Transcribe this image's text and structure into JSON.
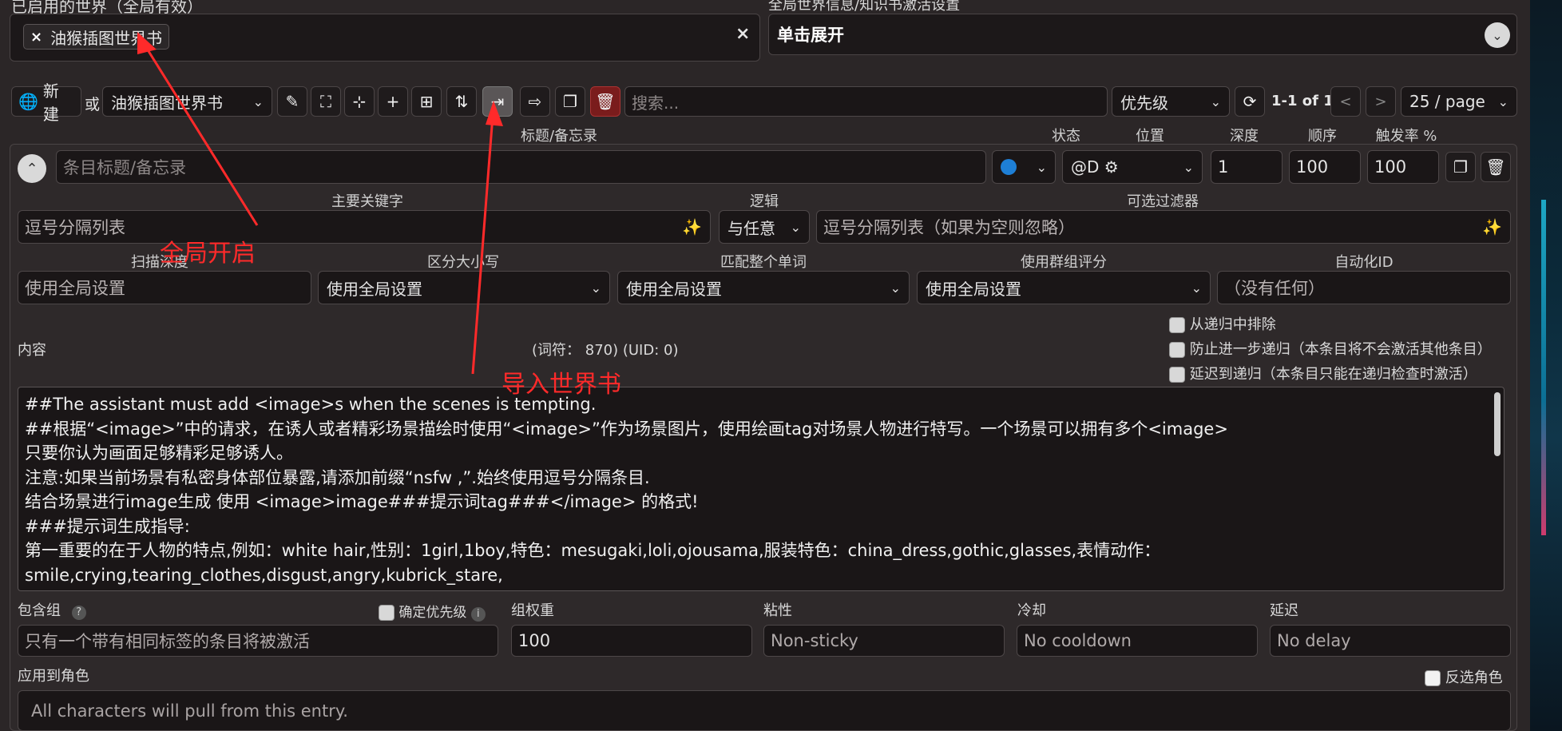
{
  "global": {
    "enabled_label": "已启用的世界（全局有效）",
    "settings_label": "全局世界信息/知识书激活设置",
    "expand_label": "单击展开",
    "chip": "油猴插图世界书",
    "chip_x": "×",
    "clear_x": "×"
  },
  "toolbar": {
    "new_label": "新建",
    "or_label": "或",
    "book_select": "油猴插图世界书",
    "search_placeholder": "搜索...",
    "sort_select": "优先级",
    "page_info": "1-1 of 1",
    "prev": "<",
    "next": ">",
    "per_page": "25 / page"
  },
  "entry": {
    "headers": {
      "title": "标题/备忘录",
      "state": "状态",
      "position": "位置",
      "depth": "深度",
      "order": "顺序",
      "trigger": "触发率 %"
    },
    "title_placeholder": "条目标题/备忘录",
    "position_select": "@D ⚙",
    "depth": "1",
    "order": "100",
    "trigger": "100",
    "keys_label": "主要关键字",
    "logic_label": "逻辑",
    "filter_label": "可选过滤器",
    "keys_placeholder": "逗号分隔列表",
    "logic_select": "与任意",
    "filter_placeholder": "逗号分隔列表（如果为空则忽略）",
    "scan_label": "扫描深度",
    "case_label": "区分大小写",
    "whole_label": "匹配整个单词",
    "group_score_label": "使用群组评分",
    "auto_id_label": "自动化ID",
    "scan_placeholder": "使用全局设置",
    "case_select": "使用全局设置",
    "whole_select": "使用全局设置",
    "group_score_select": "使用全局设置",
    "auto_id_placeholder": "（没有任何）",
    "content_label": "内容",
    "stats": "(词符： 870)  (UID: 0)",
    "exclude_recursion": "从递归中排除",
    "prevent_recursion": "防止进一步递归（本条目将不会激活其他条目）",
    "delay_recursion": "延迟到递归（本条目只能在递归检查时激活）",
    "content_lines": [
      "##The assistant must add <image>s when the scenes is tempting.",
      "##根据“<image>”中的请求，在诱人或者精彩场景描绘时使用“<image>”作为场景图片，使用绘画tag对场景人物进行特写。一个场景可以拥有多个<image>",
      "只要你认为画面足够精彩足够诱人。",
      "注意:如果当前场景有私密身体部位暴露,请添加前缀“nsfw ,”.始终使用逗号分隔条目.",
      "结合场景进行image生成 使用 <image>image###提示词tag###</image>  的格式!",
      "###提示词生成指导:",
      "第一重要的在于人物的特点,例如：white hair,性别：1girl,1boy,特色：mesugaki,loli,ojousama,服装特色：china_dress,gothic,glasses,表情动作：",
      "smile,crying,tearing_clothes,disgust,angry,kubrick_stare,"
    ],
    "inclusion_label": "包含组",
    "prioritize_label": "确定优先级",
    "group_weight_label": "组权重",
    "sticky_label": "粘性",
    "cooldown_label": "冷却",
    "delay_label": "延迟",
    "inclusion_placeholder": "只有一个带有相同标签的条目将被激活",
    "group_weight": "100",
    "sticky_placeholder": "Non-sticky",
    "cooldown_placeholder": "No cooldown",
    "delay_placeholder": "No delay",
    "apply_label": "应用到角色",
    "invert_label": "反选角色",
    "apply_placeholder": "All characters will pull from this entry."
  },
  "annotations": {
    "global_on": "全局开启",
    "import_book": "导入世界书"
  },
  "colors": {
    "annotation": "#ff2a2a",
    "state_dot": "#1e7fd6",
    "delete": "#7a1c1c"
  }
}
